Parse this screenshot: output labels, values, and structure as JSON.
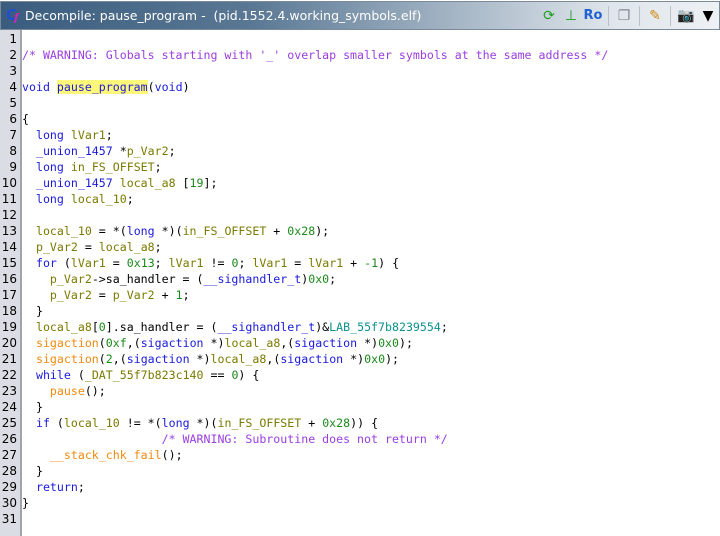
{
  "window": {
    "title": "Decompile: pause_program -  (pid.1552.4.working_symbols.elf)",
    "logo_text": "Cf",
    "toolbar": [
      {
        "name": "refresh-icon",
        "glyph": "⟳",
        "color": "#20a020"
      },
      {
        "name": "graph-icon",
        "glyph": "⊥",
        "color": "#20a020"
      },
      {
        "name": "read-only-button",
        "glyph": "Ro",
        "color": "#2060d0"
      },
      {
        "name": "copy-icon",
        "glyph": "❐",
        "color": "#808890"
      },
      {
        "name": "edit-icon",
        "glyph": "✎",
        "color": "#d08a10"
      },
      {
        "name": "snapshot-icon",
        "glyph": "📷",
        "color": "#222"
      },
      {
        "name": "menu-dropdown-icon",
        "glyph": "▼",
        "color": "#000"
      }
    ]
  },
  "lines": [
    [],
    [
      [
        "cm",
        "/* WARNING: Globals starting with '_' overlap smaller symbols at the same address */"
      ]
    ],
    [],
    [
      [
        "kw",
        "void"
      ],
      [
        "plain",
        " "
      ],
      [
        "hl",
        "pause_program"
      ],
      [
        "plain",
        "("
      ],
      [
        "kw",
        "void"
      ],
      [
        "plain",
        ")"
      ]
    ],
    [],
    [
      [
        "plain",
        "{"
      ]
    ],
    [
      [
        "plain",
        "  "
      ],
      [
        "kw",
        "long"
      ],
      [
        "plain",
        " "
      ],
      [
        "var",
        "lVar1"
      ],
      [
        "plain",
        ";"
      ]
    ],
    [
      [
        "plain",
        "  "
      ],
      [
        "ty",
        "_union_1457"
      ],
      [
        "plain",
        " *"
      ],
      [
        "var",
        "p_Var2"
      ],
      [
        "plain",
        ";"
      ]
    ],
    [
      [
        "plain",
        "  "
      ],
      [
        "kw",
        "long"
      ],
      [
        "plain",
        " "
      ],
      [
        "var",
        "in_FS_OFFSET"
      ],
      [
        "plain",
        ";"
      ]
    ],
    [
      [
        "plain",
        "  "
      ],
      [
        "ty",
        "_union_1457"
      ],
      [
        "plain",
        " "
      ],
      [
        "var",
        "local_a8"
      ],
      [
        "plain",
        " ["
      ],
      [
        "num",
        "19"
      ],
      [
        "plain",
        "];"
      ]
    ],
    [
      [
        "plain",
        "  "
      ],
      [
        "kw",
        "long"
      ],
      [
        "plain",
        " "
      ],
      [
        "var",
        "local_10"
      ],
      [
        "plain",
        ";"
      ]
    ],
    [],
    [
      [
        "plain",
        "  "
      ],
      [
        "var",
        "local_10"
      ],
      [
        "plain",
        " = *("
      ],
      [
        "kw",
        "long"
      ],
      [
        "plain",
        " *)("
      ],
      [
        "var",
        "in_FS_OFFSET"
      ],
      [
        "plain",
        " + "
      ],
      [
        "num",
        "0x28"
      ],
      [
        "plain",
        ");"
      ]
    ],
    [
      [
        "plain",
        "  "
      ],
      [
        "var",
        "p_Var2"
      ],
      [
        "plain",
        " = "
      ],
      [
        "var",
        "local_a8"
      ],
      [
        "plain",
        ";"
      ]
    ],
    [
      [
        "plain",
        "  "
      ],
      [
        "kw",
        "for"
      ],
      [
        "plain",
        " ("
      ],
      [
        "var",
        "lVar1"
      ],
      [
        "plain",
        " = "
      ],
      [
        "num",
        "0x13"
      ],
      [
        "plain",
        "; "
      ],
      [
        "var",
        "lVar1"
      ],
      [
        "plain",
        " != "
      ],
      [
        "num",
        "0"
      ],
      [
        "plain",
        "; "
      ],
      [
        "var",
        "lVar1"
      ],
      [
        "plain",
        " = "
      ],
      [
        "var",
        "lVar1"
      ],
      [
        "plain",
        " + "
      ],
      [
        "num",
        "-1"
      ],
      [
        "plain",
        ") {"
      ]
    ],
    [
      [
        "plain",
        "    "
      ],
      [
        "var",
        "p_Var2"
      ],
      [
        "plain",
        "->sa_handler = ("
      ],
      [
        "ty",
        "__sighandler_t"
      ],
      [
        "plain",
        ")"
      ],
      [
        "num",
        "0x0"
      ],
      [
        "plain",
        ";"
      ]
    ],
    [
      [
        "plain",
        "    "
      ],
      [
        "var",
        "p_Var2"
      ],
      [
        "plain",
        " = "
      ],
      [
        "var",
        "p_Var2"
      ],
      [
        "plain",
        " + "
      ],
      [
        "num",
        "1"
      ],
      [
        "plain",
        ";"
      ]
    ],
    [
      [
        "plain",
        "  }"
      ]
    ],
    [
      [
        "plain",
        "  "
      ],
      [
        "var",
        "local_a8"
      ],
      [
        "plain",
        "["
      ],
      [
        "num",
        "0"
      ],
      [
        "plain",
        "].sa_handler = ("
      ],
      [
        "ty",
        "__sighandler_t"
      ],
      [
        "plain",
        ")&"
      ],
      [
        "lab",
        "LAB_55f7b8239554"
      ],
      [
        "plain",
        ";"
      ]
    ],
    [
      [
        "plain",
        "  "
      ],
      [
        "fn",
        "sigaction"
      ],
      [
        "plain",
        "("
      ],
      [
        "num",
        "0xf"
      ],
      [
        "plain",
        ",("
      ],
      [
        "ty",
        "sigaction"
      ],
      [
        "plain",
        " *)"
      ],
      [
        "var",
        "local_a8"
      ],
      [
        "plain",
        ",("
      ],
      [
        "ty",
        "sigaction"
      ],
      [
        "plain",
        " *)"
      ],
      [
        "num",
        "0x0"
      ],
      [
        "plain",
        ");"
      ]
    ],
    [
      [
        "plain",
        "  "
      ],
      [
        "fn",
        "sigaction"
      ],
      [
        "plain",
        "("
      ],
      [
        "num",
        "2"
      ],
      [
        "plain",
        ",("
      ],
      [
        "ty",
        "sigaction"
      ],
      [
        "plain",
        " *)"
      ],
      [
        "var",
        "local_a8"
      ],
      [
        "plain",
        ",("
      ],
      [
        "ty",
        "sigaction"
      ],
      [
        "plain",
        " *)"
      ],
      [
        "num",
        "0x0"
      ],
      [
        "plain",
        ");"
      ]
    ],
    [
      [
        "plain",
        "  "
      ],
      [
        "kw",
        "while"
      ],
      [
        "plain",
        " ("
      ],
      [
        "var",
        "_DAT_55f7b823c140"
      ],
      [
        "plain",
        " == "
      ],
      [
        "num",
        "0"
      ],
      [
        "plain",
        ") {"
      ]
    ],
    [
      [
        "plain",
        "    "
      ],
      [
        "fn",
        "pause"
      ],
      [
        "plain",
        "();"
      ]
    ],
    [
      [
        "plain",
        "  }"
      ]
    ],
    [
      [
        "plain",
        "  "
      ],
      [
        "kw",
        "if"
      ],
      [
        "plain",
        " ("
      ],
      [
        "var",
        "local_10"
      ],
      [
        "plain",
        " != *("
      ],
      [
        "kw",
        "long"
      ],
      [
        "plain",
        " *)("
      ],
      [
        "var",
        "in_FS_OFFSET"
      ],
      [
        "plain",
        " + "
      ],
      [
        "num",
        "0x28"
      ],
      [
        "plain",
        ")) {"
      ]
    ],
    [
      [
        "plain",
        "                    "
      ],
      [
        "cm",
        "/* WARNING: Subroutine does not return */"
      ]
    ],
    [
      [
        "plain",
        "    "
      ],
      [
        "fn",
        "__stack_chk_fail"
      ],
      [
        "plain",
        "();"
      ]
    ],
    [
      [
        "plain",
        "  }"
      ]
    ],
    [
      [
        "plain",
        "  "
      ],
      [
        "kw",
        "return"
      ],
      [
        "plain",
        ";"
      ]
    ],
    [
      [
        "plain",
        "}"
      ]
    ],
    []
  ]
}
